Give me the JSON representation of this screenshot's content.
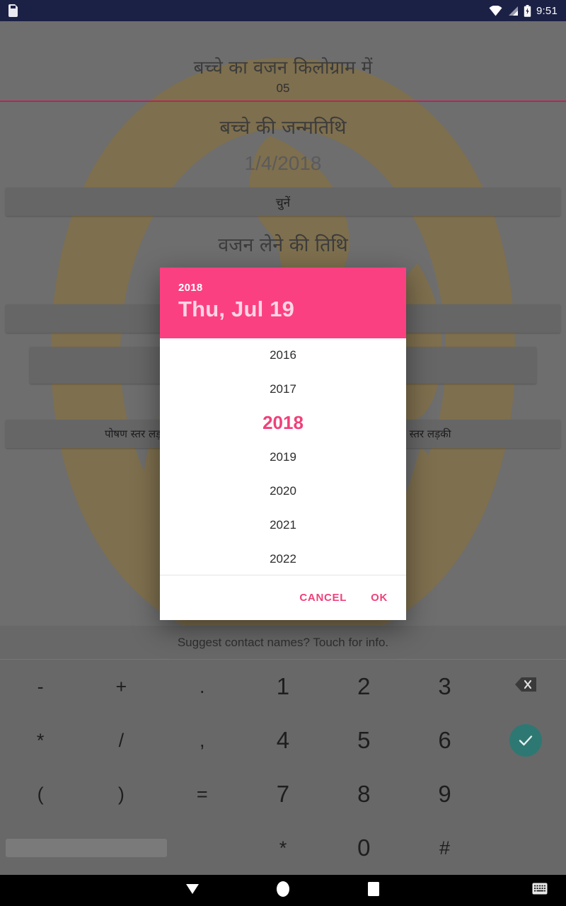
{
  "statusbar": {
    "sd_icon": "sd-card-icon",
    "wifi_icon": "wifi-no-internet-icon",
    "signal_icon": "cellular-signal-icon",
    "battery_icon": "battery-icon",
    "time": "9:51"
  },
  "app": {
    "weight_label": "बच्चे का वजन किलोग्राम में",
    "weight_value": "05",
    "dob_label": "बच्चे की जन्मतिथि",
    "dob_value": "1/4/2018",
    "select_button": "चुनें",
    "weight_date_label": "वजन लेने की तिथि",
    "button_row1": "",
    "button_row2": "",
    "nutrition_left": "पोषण स्तर लड़",
    "nutrition_right": "ण स्तर लड़की",
    "accent_underline": "#b9245a",
    "button_bg": "#666666",
    "watermark_color": "#96701e"
  },
  "dialog": {
    "header_year": "2018",
    "header_date": "Thu, Jul 19",
    "header_color": "#fb4081",
    "accent_color": "#f0417a",
    "years": [
      {
        "label": "2016",
        "selected": false
      },
      {
        "label": "2017",
        "selected": false
      },
      {
        "label": "2018",
        "selected": true
      },
      {
        "label": "2019",
        "selected": false
      },
      {
        "label": "2020",
        "selected": false
      },
      {
        "label": "2021",
        "selected": false
      },
      {
        "label": "2022",
        "selected": false
      }
    ],
    "cancel_label": "CANCEL",
    "ok_label": "OK"
  },
  "keyboard": {
    "suggestion_text": "Suggest contact names? Touch for info.",
    "rows": [
      [
        "-",
        "+",
        ".",
        "1",
        "2",
        "3",
        "backspace-icon"
      ],
      [
        "*",
        "/",
        ",",
        "4",
        "5",
        "6",
        "enter-check-icon"
      ],
      [
        "(",
        ")",
        "=",
        "7",
        "8",
        "9",
        ""
      ],
      [
        "space",
        "*",
        "0",
        "#",
        ""
      ]
    ],
    "enter_key_color": "#2e7873"
  },
  "navbar": {
    "back_icon": "back-triangle-icon",
    "home_icon": "home-circle-icon",
    "recents_icon": "recents-square-icon",
    "keyboard_icon": "keyboard-icon"
  }
}
